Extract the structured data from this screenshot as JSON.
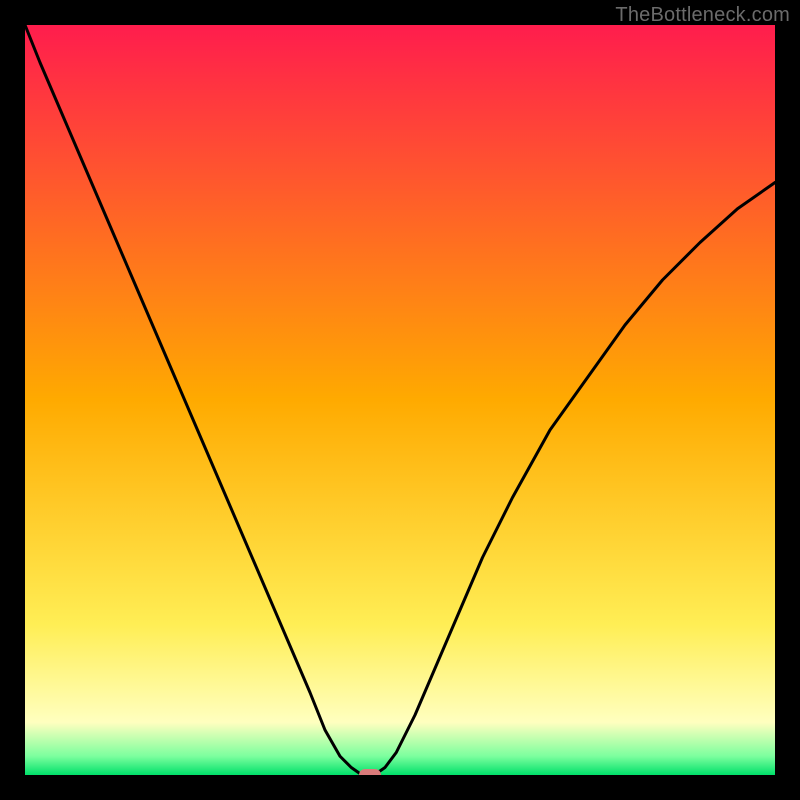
{
  "watermark": "TheBottleneck.com",
  "chart_data": {
    "type": "line",
    "title": "",
    "xlabel": "",
    "ylabel": "",
    "xlim": [
      0,
      100
    ],
    "ylim": [
      0,
      100
    ],
    "grid": false,
    "legend": false,
    "background_gradient": {
      "stops": [
        {
          "pos": 0.0,
          "color": "#ff1d4d"
        },
        {
          "pos": 0.5,
          "color": "#ffaa00"
        },
        {
          "pos": 0.8,
          "color": "#ffee55"
        },
        {
          "pos": 0.93,
          "color": "#ffffbf"
        },
        {
          "pos": 0.975,
          "color": "#7cff9e"
        },
        {
          "pos": 1.0,
          "color": "#00e06a"
        }
      ]
    },
    "series": [
      {
        "name": "bottleneck-curve",
        "x": [
          0,
          2,
          5,
          8,
          11,
          14,
          17,
          20,
          23,
          26,
          29,
          32,
          35,
          38,
          40,
          42,
          43.5,
          44.5,
          45,
          46,
          47,
          48,
          49.5,
          52,
          55,
          58,
          61,
          65,
          70,
          75,
          80,
          85,
          90,
          95,
          100
        ],
        "y": [
          100,
          95,
          88,
          81,
          74,
          67,
          60,
          53,
          46,
          39,
          32,
          25,
          18,
          11,
          6,
          2.5,
          1,
          0.3,
          0,
          0,
          0.3,
          1,
          3,
          8,
          15,
          22,
          29,
          37,
          46,
          53,
          60,
          66,
          71,
          75.5,
          79
        ]
      }
    ],
    "marker": {
      "x": 46,
      "y": 0,
      "color": "#d97a7a"
    }
  }
}
